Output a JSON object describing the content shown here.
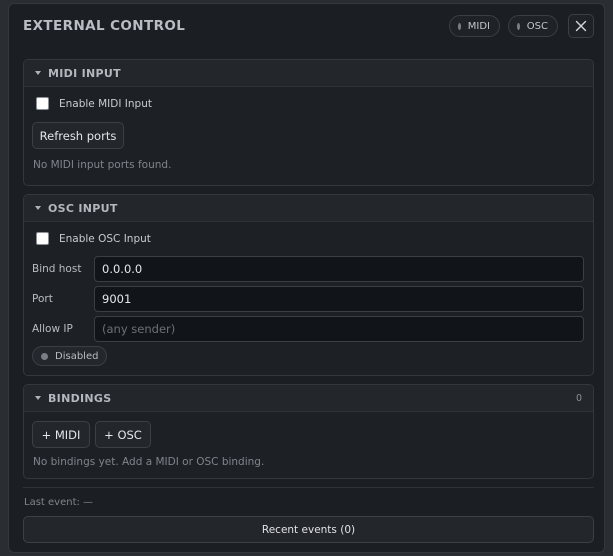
{
  "header": {
    "title": "EXTERNAL CONTROL",
    "midi_badge": "MIDI",
    "osc_badge": "OSC",
    "close_icon": "close-icon"
  },
  "midi_input": {
    "title": "MIDI INPUT",
    "enable_label": "Enable MIDI Input",
    "enabled": false,
    "refresh_button": "Refresh ports",
    "status_text": "No MIDI input ports found."
  },
  "osc_input": {
    "title": "OSC INPUT",
    "enable_label": "Enable OSC Input",
    "enabled": false,
    "bind_host_label": "Bind host",
    "bind_host_value": "0.0.0.0",
    "port_label": "Port",
    "port_value": "9001",
    "allow_ip_label": "Allow IP",
    "allow_ip_value": "",
    "allow_ip_placeholder": "(any sender)",
    "status": "Disabled"
  },
  "bindings": {
    "title": "BINDINGS",
    "count": "0",
    "add_midi_button": "+ MIDI",
    "add_osc_button": "+ OSC",
    "empty_text": "No bindings yet. Add a MIDI or OSC binding."
  },
  "footer": {
    "last_event": "Last event: —",
    "recent_events_button": "Recent events (0)"
  },
  "colors": {
    "panel_bg": "#1b1e23",
    "section_bg": "#1d2025",
    "section_header_bg": "#23272c",
    "border": "#34383e",
    "text": "#c9cdd2",
    "muted_text": "#7f858c",
    "status_dot_inactive": "#7a7f86"
  }
}
